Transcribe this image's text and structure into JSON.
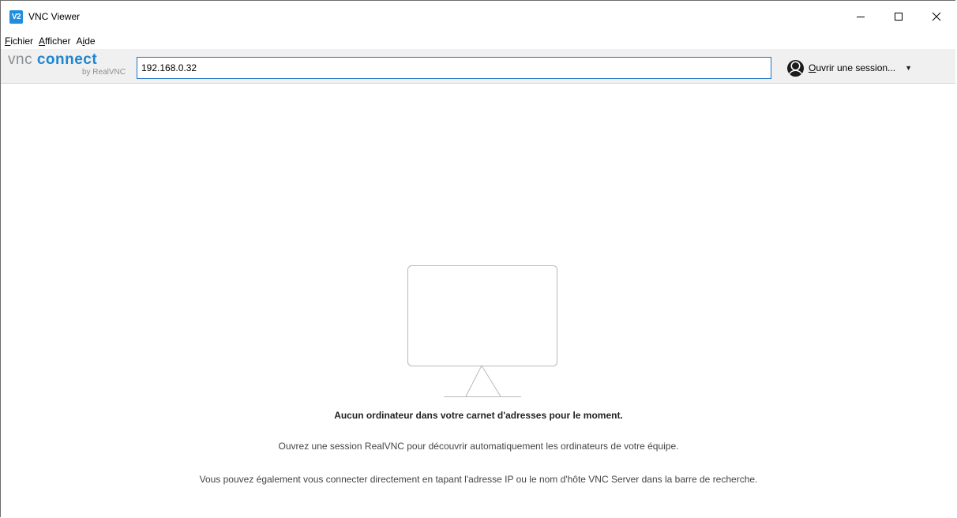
{
  "window": {
    "title": "VNC Viewer",
    "app_icon_text": "V2"
  },
  "menu": [
    {
      "prefix": "",
      "underlined": "F",
      "rest": "ichier"
    },
    {
      "prefix": "",
      "underlined": "A",
      "rest": "fficher"
    },
    {
      "prefix": "A",
      "underlined": "i",
      "rest": "de"
    }
  ],
  "toolbar": {
    "logo_vnc": "vnc",
    "logo_connect": "connect",
    "logo_sub": "by RealVNC",
    "address_value": "192.168.0.32",
    "session_underlined": "O",
    "session_rest": "uvrir une session..."
  },
  "empty_state": {
    "title": "Aucun ordinateur dans votre carnet d'adresses pour le moment.",
    "line1": "Ouvrez une session RealVNC pour découvrir automatiquement les ordinateurs de votre équipe.",
    "line2": "Vous pouvez également vous connecter directement en tapant l'adresse IP ou le nom d'hôte VNC Server dans la barre de recherche."
  },
  "colors": {
    "accent": "#1f86cf",
    "input_border": "#1f72c4",
    "toolbar_bg": "#f0f0f0"
  }
}
